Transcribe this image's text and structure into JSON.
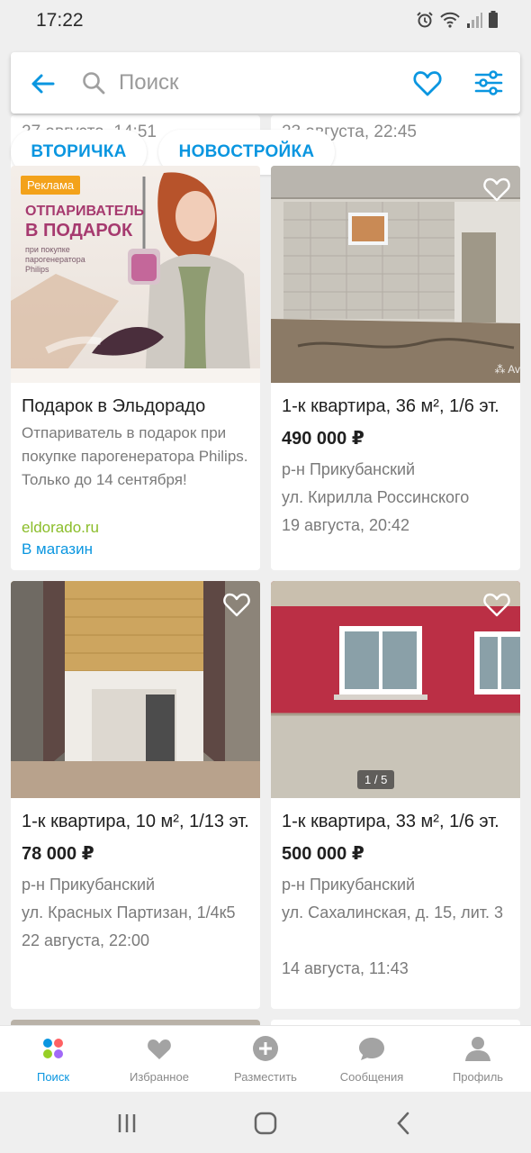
{
  "status_bar": {
    "time": "17:22",
    "icons": [
      "alarm-icon",
      "wifi-icon",
      "signal-icon",
      "battery-icon"
    ]
  },
  "search": {
    "placeholder": "Поиск"
  },
  "peek": {
    "left_text": "27 августа, 14:51",
    "right_text": "23 августа, 22:45"
  },
  "chips": [
    "ВТОРИЧКА",
    "НОВОСТРОЙКА"
  ],
  "ad": {
    "badge": "Реклама",
    "image_heading": "ОТПАРИВАТЕЛЬ В ПОДАРОК",
    "image_sub": "при покупке парогенератора Philips",
    "title": "Подарок в Эльдорадо",
    "description": "Отпариватель в подарок при покупке парогенератора Philips. Только до 14 сентября!",
    "domain": "eldorado.ru",
    "link": "В магазин"
  },
  "listings": [
    {
      "title": "1-к квартира, 36 м², 1/6 эт.",
      "price": "490 000 ₽",
      "district": "р-н Прикубанский",
      "address": "ул. Кирилла Россинского",
      "date": "19 августа, 20:42"
    },
    {
      "title": "1-к квартира, 10 м², 1/13 эт.",
      "price": "78 000 ₽",
      "district": "р-н Прикубанский",
      "address": "ул. Красных Партизан, 1/4к5",
      "date": "22 августа, 22:00"
    },
    {
      "title": "1-к квартира, 33 м², 1/6 эт.",
      "price": "500 000 ₽",
      "district": "р-н Прикубанский",
      "address": "ул. Сахалинская, д. 15, лит. 3",
      "date": "14 августа, 11:43",
      "photo_counter": "1 / 5"
    }
  ],
  "bottom_nav": [
    {
      "label": "Поиск",
      "icon": "search-dots-icon",
      "active": true
    },
    {
      "label": "Избранное",
      "icon": "heart-icon"
    },
    {
      "label": "Разместить",
      "icon": "plus-circle-icon"
    },
    {
      "label": "Сообщения",
      "icon": "chat-bubble-icon"
    },
    {
      "label": "Профиль",
      "icon": "person-icon"
    }
  ],
  "colors": {
    "accent": "#0a96e0",
    "ad_domain": "#8bbd2a",
    "ad_badge": "#f3a21b"
  }
}
